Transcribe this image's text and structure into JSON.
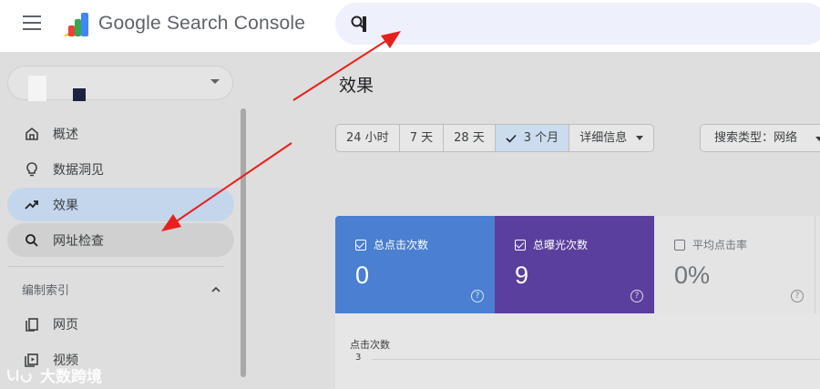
{
  "header": {
    "app_title": "Google Search Console",
    "search_placeholder": ""
  },
  "sidebar": {
    "items": [
      {
        "label": "概述",
        "icon": "home-icon"
      },
      {
        "label": "数据洞见",
        "icon": "lightbulb-icon"
      },
      {
        "label": "效果",
        "icon": "trending-up-icon",
        "active": true
      },
      {
        "label": "网址检查",
        "icon": "search-icon",
        "hovered": true
      }
    ],
    "section_label": "编制索引",
    "section_items": [
      {
        "label": "网页",
        "icon": "pages-icon"
      },
      {
        "label": "视频",
        "icon": "video-icon"
      }
    ]
  },
  "main": {
    "title": "效果",
    "date_filters": [
      "24 小时",
      "7 天",
      "28 天",
      "3 个月"
    ],
    "selected_filter": "3 个月",
    "more_filter": "详细信息",
    "search_type": "搜索类型：网络"
  },
  "metrics": [
    {
      "label": "总点击次数",
      "value": "0",
      "checked": true,
      "color": "#4a7fd1"
    },
    {
      "label": "总曝光次数",
      "value": "9",
      "checked": true,
      "color": "#5b3f9e"
    },
    {
      "label": "平均点击率",
      "value": "0%",
      "checked": false,
      "color": "#e4e4e4"
    }
  ],
  "chart": {
    "label": "点击次数",
    "tick": "3"
  },
  "watermark": "大数跨境",
  "colors": {
    "accent": "#4a7fd1",
    "annotation": "#e8201c",
    "active_nav": "#c3d6ec"
  }
}
